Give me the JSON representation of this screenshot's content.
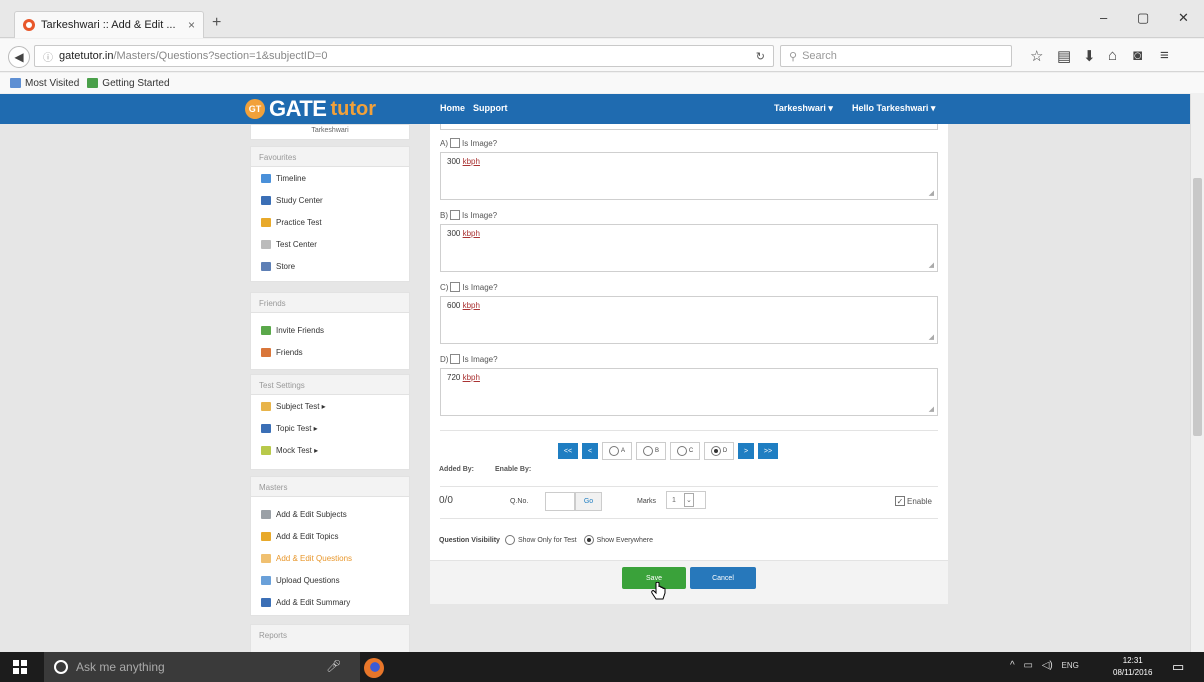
{
  "browser": {
    "tab_title": "Tarkeshwari :: Add & Edit ...",
    "tab_close": "×",
    "new_tab": "+",
    "url_host": "gatetutor.in",
    "url_path": "/Masters/Questions?section=1&subjectID=0",
    "search_placeholder": "Search",
    "bookmarks": [
      "Most Visited",
      "Getting Started"
    ],
    "win_min": "–",
    "win_max": "▢",
    "win_close": "✕"
  },
  "site": {
    "logo_badge": "GT",
    "logo_gate": "GATE",
    "logo_tutor": "tutor",
    "nav_home": "Home",
    "nav_support": "Support",
    "nav_user": "Tarkeshwari ▾",
    "nav_hello": "Hello Tarkeshwari ▾",
    "user_name": "Tarkeshwari"
  },
  "sidebar": {
    "favourites_head": "Favourites",
    "favourites": [
      "Timeline",
      "Study Center",
      "Practice Test",
      "Test Center",
      "Store"
    ],
    "friends_head": "Friends",
    "friends": [
      "Invite Friends",
      "Friends"
    ],
    "test_head": "Test Settings",
    "test_items": [
      "Subject Test ▸",
      "Topic Test ▸",
      "Mock Test ▸"
    ],
    "masters_head": "Masters",
    "masters": [
      "Add & Edit Subjects",
      "Add & Edit Topics",
      "Add & Edit Questions",
      "Upload Questions",
      "Add & Edit Summary"
    ],
    "reports_head": "Reports"
  },
  "form": {
    "options": [
      {
        "letter": "A)",
        "is_image": "Is Image?",
        "value": "300",
        "unit": "kbph"
      },
      {
        "letter": "B)",
        "is_image": "Is Image?",
        "value": "300",
        "unit": "kbph"
      },
      {
        "letter": "C)",
        "is_image": "Is Image?",
        "value": "600",
        "unit": "kbph"
      },
      {
        "letter": "D)",
        "is_image": "Is Image?",
        "value": "720",
        "unit": "kbph"
      }
    ],
    "pager": {
      "first": "<<",
      "prev": "<",
      "next": ">",
      "last": ">>"
    },
    "answer_choices": [
      "A",
      "B",
      "C",
      "D"
    ],
    "selected_answer": "D",
    "added_by": "Added By:",
    "enable_by": "Enable By:",
    "count": "0/0",
    "qno_label": "Q.No.",
    "go": "Go",
    "marks_label": "Marks",
    "marks_value": "1",
    "enable_label": "Enable",
    "enable_checked": true,
    "visibility_label": "Question Visibility",
    "vis_option1": "Show Only for Test",
    "vis_option2": "Show Everywhere",
    "save": "Save",
    "cancel": "Cancel"
  },
  "taskbar": {
    "search_placeholder": "Ask me anything",
    "lang": "ENG",
    "time": "12:31",
    "date": "08/11/2016"
  }
}
